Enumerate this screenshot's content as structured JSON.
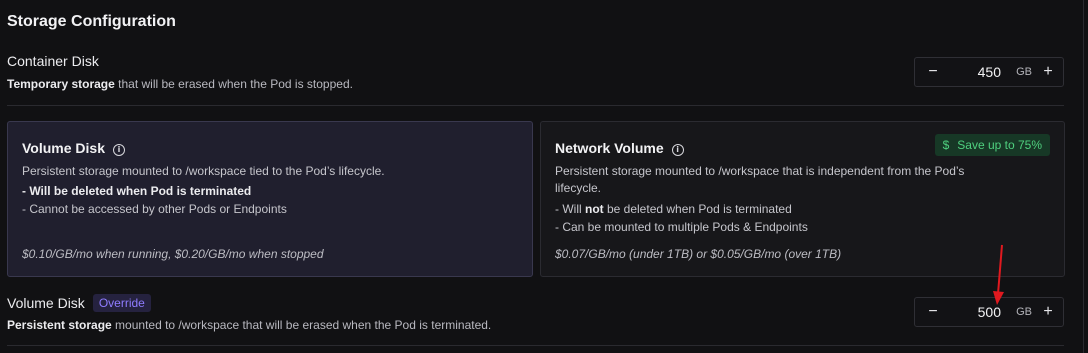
{
  "title": "Storage Configuration",
  "container_disk": {
    "label": "Container Disk",
    "desc_bold": "Temporary storage",
    "desc_rest": " that will be erased when the Pod is stopped.",
    "stepper": {
      "minus": "−",
      "value": "450",
      "unit": "GB",
      "plus": "+"
    }
  },
  "cards": {
    "volume": {
      "title": "Volume Disk",
      "line1": "Persistent storage mounted to /workspace tied to the Pod’s lifecycle.",
      "line2": "- Will be deleted when Pod is terminated",
      "line3": "- Cannot be accessed by other Pods or Endpoints",
      "price": "$0.10/GB/mo when running, $0.20/GB/mo when stopped"
    },
    "network": {
      "title": "Network Volume",
      "badge_icon": "$",
      "badge_text": "Save up to 75%",
      "line1a": "Persistent storage mounted to /workspace that is independent from the Pod’s",
      "line1b": "lifecycle.",
      "line2_pre": "- Will ",
      "line2_bold": "not",
      "line2_post": " be deleted when Pod is terminated",
      "line3": "- Can be mounted to multiple Pods & Endpoints",
      "price": "$0.07/GB/mo (under 1TB) or $0.05/GB/mo (over 1TB)"
    }
  },
  "volume_disk": {
    "label": "Volume Disk",
    "badge": "Override",
    "desc_bold": "Persistent storage",
    "desc_rest": " mounted to /workspace that will be erased when the Pod is terminated.",
    "stepper": {
      "minus": "−",
      "value": "500",
      "unit": "GB",
      "plus": "+"
    }
  },
  "colors": {
    "background": "#111113",
    "selected_card": "#201f2e",
    "save_badge_text": "#4fd07f",
    "override_badge_text": "#8f7cff",
    "annotation_arrow": "#e0191f"
  },
  "icons": [
    "info-icon",
    "dollar-icon",
    "minus-icon",
    "plus-icon",
    "arrow-annotation"
  ]
}
